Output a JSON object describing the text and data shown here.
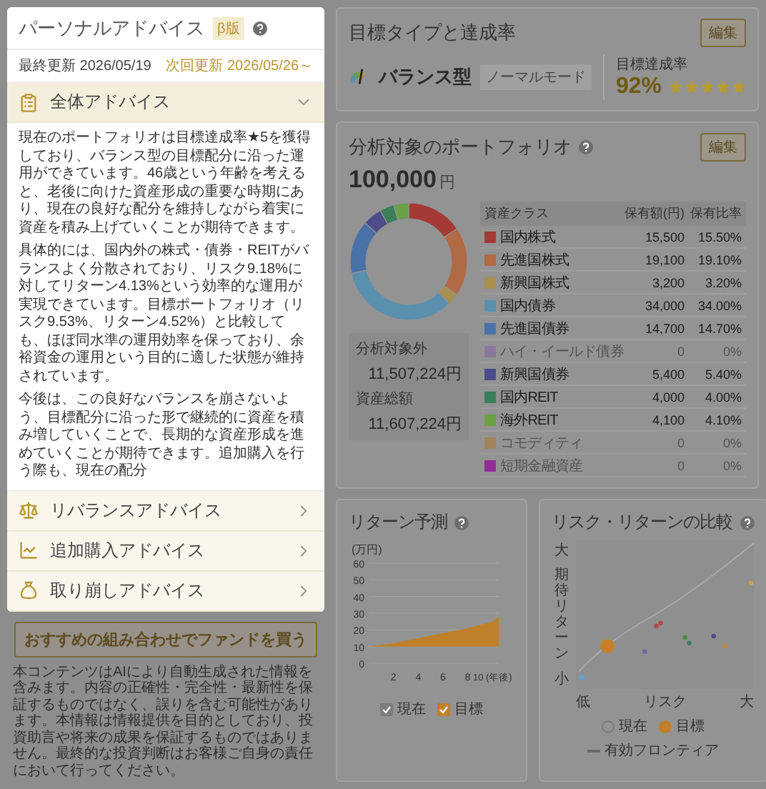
{
  "advice_panel": {
    "title": "パーソナルアドバイス",
    "badge": "β版",
    "last_updated": "最終更新 2026/05/19",
    "next_update": "次回更新 2026/05/26～",
    "sections": [
      {
        "kind": "overall",
        "label": "全体アドバイス",
        "expanded": true,
        "paragraphs": [
          "現在のポートフォリオは目標達成率★5を獲得しており、バランス型の目標配分に沿った運用ができています。46歳という年齢を考えると、老後に向けた資産形成の重要な時期にあり、現在の良好な配分を維持しながら着実に資産を積み上げていくことが期待できます。",
          "具体的には、国内外の株式・債券・REITがバランスよく分散されており、リスク9.18%に対してリターン4.13%という効率的な運用が実現できています。目標ポートフォリオ（リスク9.53%、リターン4.52%）と比較しても、ほぼ同水準の運用効率を保っており、余裕資金の運用という目的に適した状態が維持されています。",
          "今後は、この良好なバランスを崩さないよう、目標配分に沿った形で継続的に資産を積み増していくことで、長期的な資産形成を進めていくことが期待できます。追加購入を行う際も、現在の配分"
        ]
      },
      {
        "kind": "rebalance",
        "label": "リバランスアドバイス",
        "expanded": false
      },
      {
        "kind": "purchase",
        "label": "追加購入アドバイス",
        "expanded": false
      },
      {
        "kind": "withdraw",
        "label": "取り崩しアドバイス",
        "expanded": false
      }
    ]
  },
  "buy_button": "おすすめの組み合わせでファンドを買う",
  "disclaimer": "本コンテンツはAIにより自動生成された情報を含みます。内容の正確性・完全性・最新性を保証するものではなく、誤りを含む可能性があります。本情報は情報提供を目的としており、投資助言や将来の成果を保証するものではありません。最終的な投資判断はお客様ご自身の責任において行ってください。",
  "goal": {
    "title": "目標タイプと達成率",
    "edit": "編集",
    "type": "バランス型",
    "mode": "ノーマルモード",
    "rate_label": "目標達成率",
    "rate": "92%",
    "stars": 5
  },
  "portfolio": {
    "title": "分析対象のポートフォリオ",
    "edit": "編集",
    "amount": "100,000",
    "unit": "円",
    "chart_data": {
      "type": "donut",
      "legend": "right",
      "categories": [
        "国内株式",
        "先進国株式",
        "新興国株式",
        "国内債券",
        "先進国債券",
        "ハイ・イールド債券",
        "新興国債券",
        "国内REIT",
        "海外REIT",
        "コモディティ",
        "短期金融資産"
      ],
      "values": [
        15.5,
        19.1,
        3.2,
        34.0,
        14.7,
        0,
        5.4,
        4.0,
        4.1,
        0,
        0
      ]
    },
    "columns": [
      "資産クラス",
      "保有額(円)",
      "保有比率"
    ],
    "rows": [
      {
        "amount": "15,500",
        "ratio": "15.50%",
        "color": "#a33a35",
        "disabled": false
      },
      {
        "amount": "19,100",
        "ratio": "19.10%",
        "color": "#b06a45",
        "disabled": false
      },
      {
        "amount": "3,200",
        "ratio": "3.20%",
        "color": "#a88f52",
        "disabled": false
      },
      {
        "amount": "34,000",
        "ratio": "34.00%",
        "color": "#5b8fae",
        "disabled": false
      },
      {
        "amount": "14,700",
        "ratio": "14.70%",
        "color": "#4a72a8",
        "disabled": false
      },
      {
        "amount": "0",
        "ratio": "0%",
        "color": "#8a7898",
        "disabled": true
      },
      {
        "amount": "5,400",
        "ratio": "5.40%",
        "color": "#4d4c8a",
        "disabled": false
      },
      {
        "amount": "4,000",
        "ratio": "4.00%",
        "color": "#3a7e5a",
        "disabled": false
      },
      {
        "amount": "4,100",
        "ratio": "4.10%",
        "color": "#6aa046",
        "disabled": false
      },
      {
        "amount": "0",
        "ratio": "0%",
        "color": "#a0845c",
        "disabled": true
      },
      {
        "amount": "0",
        "ratio": "0%",
        "color": "#902e96",
        "disabled": true
      }
    ],
    "summary": [
      {
        "label": "分析対象外",
        "value": "11,507,224",
        "unit": "円"
      },
      {
        "label": "資産総額",
        "value": "11,607,224",
        "unit": "円"
      }
    ]
  },
  "return_forecast": {
    "title": "リターン予測",
    "chart_data": {
      "type": "area",
      "grid": true,
      "ylabel": "(万円)",
      "x": [
        0,
        2,
        4,
        6,
        8,
        10,
        10.5
      ],
      "xlim": [
        0,
        10.5
      ],
      "ylim": [
        0,
        60
      ],
      "yticks": [
        0,
        10,
        20,
        30,
        40,
        50,
        60
      ],
      "xticks": [
        2,
        4,
        6,
        8,
        {
          "value": 10,
          "label": "10 (年後)"
        }
      ],
      "series": [
        {
          "name": "目標",
          "color": "#c0802a",
          "values": [
            10,
            12,
            15,
            18,
            21,
            25,
            28
          ]
        }
      ]
    },
    "legend": [
      {
        "label": "現在",
        "color": "#7c7c7c"
      }
    ]
  },
  "risk_return": {
    "title": "リスク・リターンの比較",
    "y_high": "大",
    "y_label": "期待リターン",
    "y_low": "小",
    "x_low": "低",
    "x_label": "リスク",
    "x_high": "大",
    "legend": [
      {
        "kind": "current",
        "label": "現在"
      },
      {
        "kind": "target",
        "label": "目標"
      },
      {
        "kind": "frontier",
        "label": "有効フロンティア"
      }
    ]
  }
}
